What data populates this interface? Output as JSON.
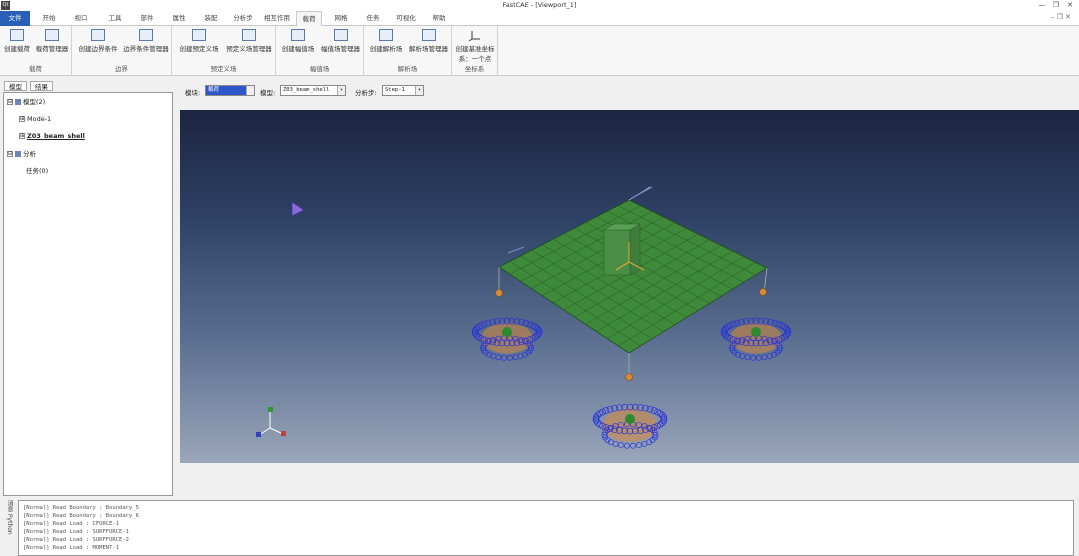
{
  "window": {
    "logo": "Qt",
    "title": "FastCAE - [Viewport_1]",
    "minimize": "—",
    "restore": "❐",
    "close": "✕"
  },
  "menu": {
    "items": [
      "文件",
      "开始",
      "视口",
      "工具",
      "部件",
      "属性",
      "装配",
      "分析步",
      "相互作用",
      "载荷",
      "网格",
      "任务",
      "可视化",
      "帮助"
    ],
    "active_index": 9,
    "right_icons": "– ❐ ✕"
  },
  "ribbon": {
    "groups": [
      {
        "label": "载荷",
        "buttons": [
          "创建载荷",
          "载荷管理器"
        ]
      },
      {
        "label": "边界",
        "buttons": [
          "创建边界条件",
          "边界条件管理器"
        ]
      },
      {
        "label": "预定义场",
        "buttons": [
          "创建预定义场",
          "预定义场管理器"
        ]
      },
      {
        "label": "幅值场",
        "buttons": [
          "创建幅值场",
          "幅值场管理器"
        ]
      },
      {
        "label": "解析场",
        "buttons": [
          "创建解析场",
          "解析场管理器"
        ]
      },
      {
        "label": "坐标系",
        "buttons": [
          "创建基准坐标系：一个点"
        ]
      }
    ]
  },
  "left_panel": {
    "tabs": [
      "模型",
      "结果"
    ],
    "tree": [
      {
        "label": "模型(2)",
        "level": 0,
        "expander": "⊟"
      },
      {
        "label": "Mode-1",
        "level": 1,
        "expander": "⊞"
      },
      {
        "label": "Z03_beam_shell",
        "level": 1,
        "expander": "⊞",
        "bold": true
      },
      {
        "label": "分析",
        "level": 0,
        "expander": "⊟"
      },
      {
        "label": "任务(0)",
        "level": 1,
        "expander": ""
      }
    ]
  },
  "view_toolbar": {
    "module_label": "模块:",
    "module_value": "载荷",
    "model_label": "模型:",
    "model_value": "Z03_beam_shell",
    "step_label": "分析步:",
    "step_value": "Step-1",
    "dropdown_glyph": "▾"
  },
  "console": {
    "side_tabs": [
      "消息",
      "Python"
    ],
    "lines": [
      "[Normal] Read Boundary : Boundary_5",
      "[Normal] Read Boundary : Boundary_6",
      "[Normal] Read Load : CFORCE-1",
      "[Normal] Read Load : SURFFORCE-1",
      "[Normal] Read Load : SURFFORCE-2",
      "[Normal] Read Load : MOMENT-1"
    ]
  },
  "colors": {
    "accent": "#2a5fb6",
    "plate": "#3f8a3a",
    "spring": "#2a35d8",
    "constraint": "#d9883a"
  }
}
